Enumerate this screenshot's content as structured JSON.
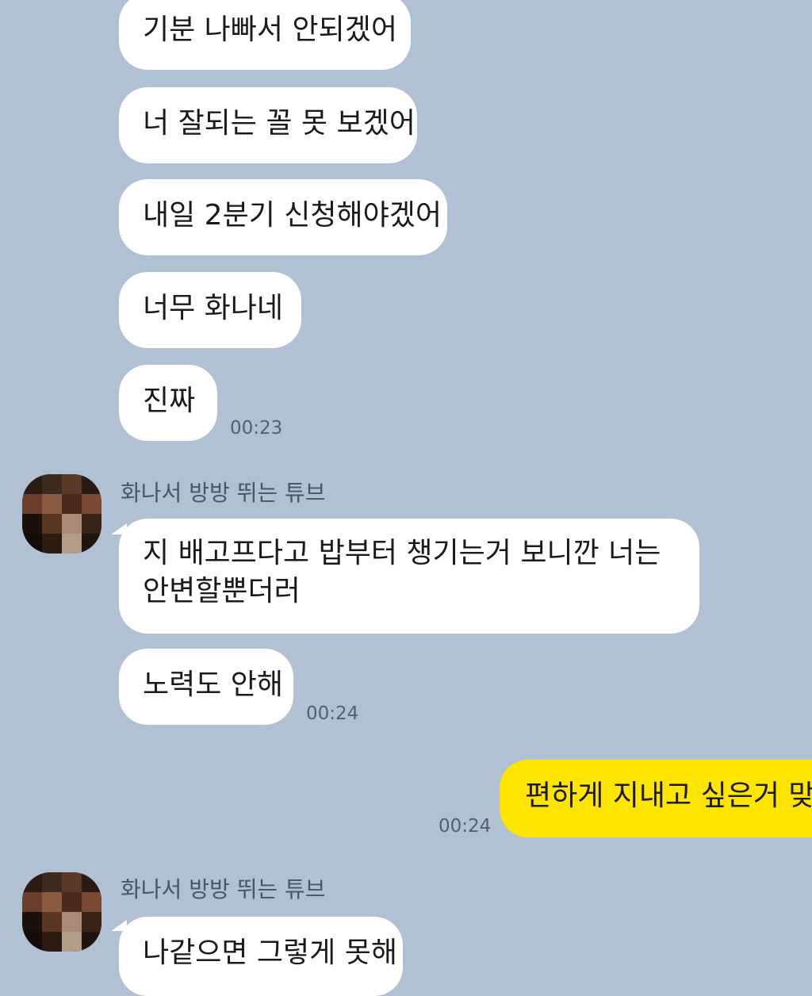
{
  "messages": [
    {
      "text": "기분 나빠서 안되겠어"
    },
    {
      "text": "너 잘되는 꼴 못 보겠어"
    },
    {
      "text": "내일 2분기 신청해야겠어"
    },
    {
      "text": "너무 화나네"
    },
    {
      "text": "진짜",
      "time": "00:23"
    },
    {
      "sender": "화나서 방방 뛰는 튜브",
      "text": "지 배고프다고 밥부터 챙기는거 보니깐 너는 안변할뿐더러"
    },
    {
      "text": "노력도 안해",
      "time": "00:24"
    },
    {
      "text": "편하게 지내고 싶은거 맞지",
      "time": "00:24",
      "mine": true
    },
    {
      "sender": "화나서 방방 뛰는 튜브",
      "text": "나같으면 그렇게 못해"
    }
  ],
  "colors": {
    "background": "#b1c1d4",
    "incoming_bubble": "#ffffff",
    "outgoing_bubble": "#fee500"
  }
}
